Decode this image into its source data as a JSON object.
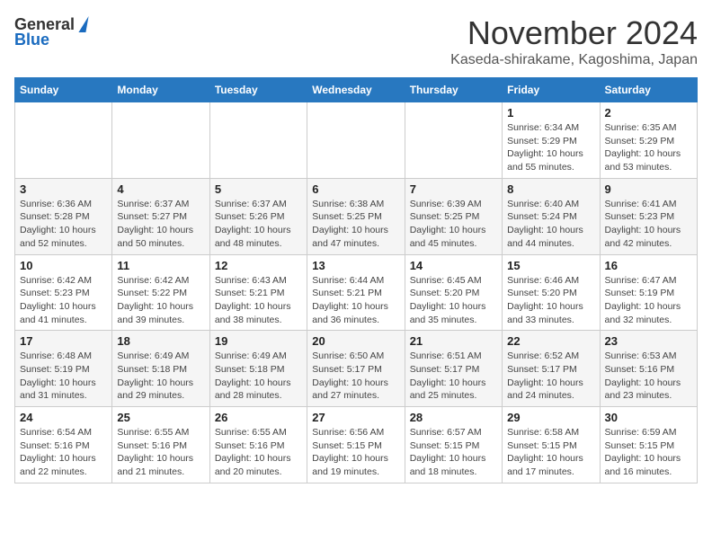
{
  "header": {
    "logo_general": "General",
    "logo_blue": "Blue",
    "month_title": "November 2024",
    "subtitle": "Kaseda-shirakame, Kagoshima, Japan"
  },
  "days_of_week": [
    "Sunday",
    "Monday",
    "Tuesday",
    "Wednesday",
    "Thursday",
    "Friday",
    "Saturday"
  ],
  "weeks": [
    [
      {
        "day": "",
        "info": ""
      },
      {
        "day": "",
        "info": ""
      },
      {
        "day": "",
        "info": ""
      },
      {
        "day": "",
        "info": ""
      },
      {
        "day": "",
        "info": ""
      },
      {
        "day": "1",
        "info": "Sunrise: 6:34 AM\nSunset: 5:29 PM\nDaylight: 10 hours and 55 minutes."
      },
      {
        "day": "2",
        "info": "Sunrise: 6:35 AM\nSunset: 5:29 PM\nDaylight: 10 hours and 53 minutes."
      }
    ],
    [
      {
        "day": "3",
        "info": "Sunrise: 6:36 AM\nSunset: 5:28 PM\nDaylight: 10 hours and 52 minutes."
      },
      {
        "day": "4",
        "info": "Sunrise: 6:37 AM\nSunset: 5:27 PM\nDaylight: 10 hours and 50 minutes."
      },
      {
        "day": "5",
        "info": "Sunrise: 6:37 AM\nSunset: 5:26 PM\nDaylight: 10 hours and 48 minutes."
      },
      {
        "day": "6",
        "info": "Sunrise: 6:38 AM\nSunset: 5:25 PM\nDaylight: 10 hours and 47 minutes."
      },
      {
        "day": "7",
        "info": "Sunrise: 6:39 AM\nSunset: 5:25 PM\nDaylight: 10 hours and 45 minutes."
      },
      {
        "day": "8",
        "info": "Sunrise: 6:40 AM\nSunset: 5:24 PM\nDaylight: 10 hours and 44 minutes."
      },
      {
        "day": "9",
        "info": "Sunrise: 6:41 AM\nSunset: 5:23 PM\nDaylight: 10 hours and 42 minutes."
      }
    ],
    [
      {
        "day": "10",
        "info": "Sunrise: 6:42 AM\nSunset: 5:23 PM\nDaylight: 10 hours and 41 minutes."
      },
      {
        "day": "11",
        "info": "Sunrise: 6:42 AM\nSunset: 5:22 PM\nDaylight: 10 hours and 39 minutes."
      },
      {
        "day": "12",
        "info": "Sunrise: 6:43 AM\nSunset: 5:21 PM\nDaylight: 10 hours and 38 minutes."
      },
      {
        "day": "13",
        "info": "Sunrise: 6:44 AM\nSunset: 5:21 PM\nDaylight: 10 hours and 36 minutes."
      },
      {
        "day": "14",
        "info": "Sunrise: 6:45 AM\nSunset: 5:20 PM\nDaylight: 10 hours and 35 minutes."
      },
      {
        "day": "15",
        "info": "Sunrise: 6:46 AM\nSunset: 5:20 PM\nDaylight: 10 hours and 33 minutes."
      },
      {
        "day": "16",
        "info": "Sunrise: 6:47 AM\nSunset: 5:19 PM\nDaylight: 10 hours and 32 minutes."
      }
    ],
    [
      {
        "day": "17",
        "info": "Sunrise: 6:48 AM\nSunset: 5:19 PM\nDaylight: 10 hours and 31 minutes."
      },
      {
        "day": "18",
        "info": "Sunrise: 6:49 AM\nSunset: 5:18 PM\nDaylight: 10 hours and 29 minutes."
      },
      {
        "day": "19",
        "info": "Sunrise: 6:49 AM\nSunset: 5:18 PM\nDaylight: 10 hours and 28 minutes."
      },
      {
        "day": "20",
        "info": "Sunrise: 6:50 AM\nSunset: 5:17 PM\nDaylight: 10 hours and 27 minutes."
      },
      {
        "day": "21",
        "info": "Sunrise: 6:51 AM\nSunset: 5:17 PM\nDaylight: 10 hours and 25 minutes."
      },
      {
        "day": "22",
        "info": "Sunrise: 6:52 AM\nSunset: 5:17 PM\nDaylight: 10 hours and 24 minutes."
      },
      {
        "day": "23",
        "info": "Sunrise: 6:53 AM\nSunset: 5:16 PM\nDaylight: 10 hours and 23 minutes."
      }
    ],
    [
      {
        "day": "24",
        "info": "Sunrise: 6:54 AM\nSunset: 5:16 PM\nDaylight: 10 hours and 22 minutes."
      },
      {
        "day": "25",
        "info": "Sunrise: 6:55 AM\nSunset: 5:16 PM\nDaylight: 10 hours and 21 minutes."
      },
      {
        "day": "26",
        "info": "Sunrise: 6:55 AM\nSunset: 5:16 PM\nDaylight: 10 hours and 20 minutes."
      },
      {
        "day": "27",
        "info": "Sunrise: 6:56 AM\nSunset: 5:15 PM\nDaylight: 10 hours and 19 minutes."
      },
      {
        "day": "28",
        "info": "Sunrise: 6:57 AM\nSunset: 5:15 PM\nDaylight: 10 hours and 18 minutes."
      },
      {
        "day": "29",
        "info": "Sunrise: 6:58 AM\nSunset: 5:15 PM\nDaylight: 10 hours and 17 minutes."
      },
      {
        "day": "30",
        "info": "Sunrise: 6:59 AM\nSunset: 5:15 PM\nDaylight: 10 hours and 16 minutes."
      }
    ]
  ]
}
